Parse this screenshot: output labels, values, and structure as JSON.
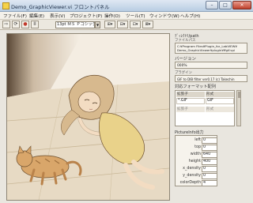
{
  "window": {
    "title": "Demo_GraphicViewer.vi フロントパネル",
    "minimize": "–",
    "maximize": "□",
    "close": "✕"
  },
  "menu": {
    "items": [
      "ファイル(F)",
      "編集(E)",
      "表示(V)",
      "プロジェクト(P)",
      "操作(O)",
      "ツール(T)",
      "ウィンドウ(W)",
      "ヘルプ(H)"
    ]
  },
  "toolbar": {
    "run": "⇨",
    "run_continuous": "⟳",
    "abort": "●",
    "pause": "II",
    "font_select": "13pt ＭＳ Ｐゴシック",
    "font_arrow": "▼",
    "align": "⊞▾",
    "distribute": "⊟▾",
    "resize": "⊡▾",
    "reorder": "⊠▾"
  },
  "panel": {
    "file_path_caption": "ﾃﾞｨﾚｸﾄﾘ/path",
    "file_path_sub": "ファイルパス",
    "file_path_value": "C:¥Program Files¥Plugin_for_LabVIEW¥ Demo_GraphicViewer¥plugin¥ffgif.spi",
    "version_caption": "バージョン",
    "version_value": "000%",
    "info_sub": "プラグイン",
    "info_value": "GIF to DIB filter ver0.17 (c) Takechin",
    "formats_caption": "対応フォーマット配列",
    "formats_header_ext": "拡張子",
    "formats_header_fmt": "形式",
    "formats_rows": [
      {
        "ext": "*.GIF",
        "fmt": "GIF"
      },
      {
        "ext": "拡張子",
        "fmt": "形式"
      }
    ],
    "picture_info_caption": "PictureInfo出力",
    "picture_info": [
      {
        "label": "left",
        "value": "0"
      },
      {
        "label": "top",
        "value": "0"
      },
      {
        "label": "width",
        "value": "640"
      },
      {
        "label": "height",
        "value": "400"
      },
      {
        "label": "x_density",
        "value": "0"
      },
      {
        "label": "y_density",
        "value": "0"
      },
      {
        "label": "colorDepth",
        "value": "4"
      }
    ]
  },
  "colors": {
    "illustration_bg": "#f4ede2",
    "sepia_dark": "#6b4e2e",
    "skin": "#f3dcc2",
    "hair": "#d7b98e",
    "dress": "#e9d28a",
    "cat": "#d9a66a",
    "floor": "#d8c7ab"
  }
}
